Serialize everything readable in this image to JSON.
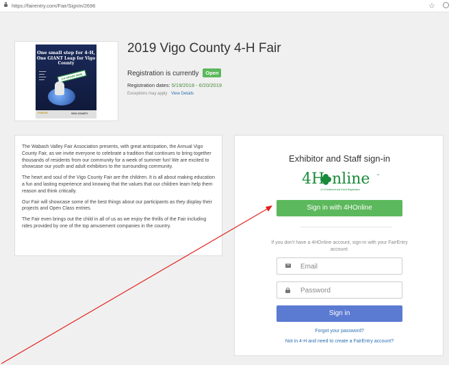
{
  "browser": {
    "url": "https://fairentry.com/Fair/SignIn/2696",
    "icons": [
      "lock-icon",
      "star-icon",
      "extension-icon"
    ]
  },
  "poster": {
    "headline_1": "One small step for 4-H,",
    "headline_2": "One GIANT Leap for Vigo County",
    "banner": "4-H GROWS HERE",
    "footer_left": "PURDUE",
    "footer_right": "VIGO COUNTY"
  },
  "fair": {
    "title": "2019 Vigo County 4-H Fair",
    "status_prefix": "Registration is currently",
    "status_badge": "Open",
    "dates_label": "Registration dates:",
    "dates_value": "5/19/2018 - 6/20/2019",
    "exceptions": "Exceptions may apply",
    "view_details": "View Details"
  },
  "description": {
    "paragraphs": [
      "The Wabash Valley Fair Association presents, with great anticipation, the Annual Vigo County Fair, as we invite everyone to celebrate a tradition that continues to bring together thousands of residents from our community for a week of summer fun! We are excited to showcase our youth and adult exhibitors to the surrounding community.",
      "The heart and soul of the Vigo County Fair are the children. It is all about making education a fun and lasting experience and knowing that the values that our children learn help them reason and think critically.",
      "Our Fair will showcase some of the best things about our participants as they display their projects and Open Class entries.",
      "The Fair even brings out the child in all of us as we enjoy the thrills of the Fair including rides provided by one of the top amusement companies in the country."
    ]
  },
  "signin": {
    "title": "Exhibitor and Staff sign-in",
    "logo": {
      "left": "4H",
      "right": "nline",
      "tm": "™",
      "subtitle": "4-H Enrollment and Event Registration"
    },
    "btn_4honline": "Sign in with 4HOnline",
    "alt_text": "If you don't have a 4HOnline account, sign-in with your FairEntry account:",
    "email_placeholder": "Email",
    "password_placeholder": "Password",
    "btn_signin": "Sign in",
    "forgot": "Forgot your password?",
    "not_in": "Not in 4-H and need to create a FairEntry account?"
  },
  "colors": {
    "green": "#5cb85c",
    "blue_button": "#5b7ad1",
    "link": "#2a6fb0",
    "annotation_arrow": "#e0201b"
  }
}
